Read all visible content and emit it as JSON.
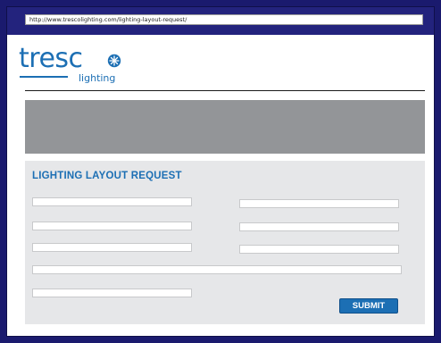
{
  "browser": {
    "url": "http://www.trescolighting.com/lighting-layout-request/"
  },
  "logo": {
    "word_prefix": "tresc",
    "word_suffix": "lighting",
    "brand_color": "#1c6fb4",
    "star_icon": "star-burst-icon"
  },
  "colors": {
    "frame": "#1a1a6e",
    "banner": "#939598",
    "form_panel": "#e6e7e9",
    "accent": "#1c6fb4"
  },
  "form": {
    "title": "LIGHTING LAYOUT REQUEST",
    "fields": [
      {
        "value": "",
        "placeholder": ""
      },
      {
        "value": "",
        "placeholder": ""
      },
      {
        "value": "",
        "placeholder": ""
      },
      {
        "value": "",
        "placeholder": ""
      },
      {
        "value": "",
        "placeholder": ""
      },
      {
        "value": "",
        "placeholder": ""
      },
      {
        "value": "",
        "placeholder": ""
      },
      {
        "value": "",
        "placeholder": ""
      }
    ],
    "submit_label": "SUBMIT"
  }
}
